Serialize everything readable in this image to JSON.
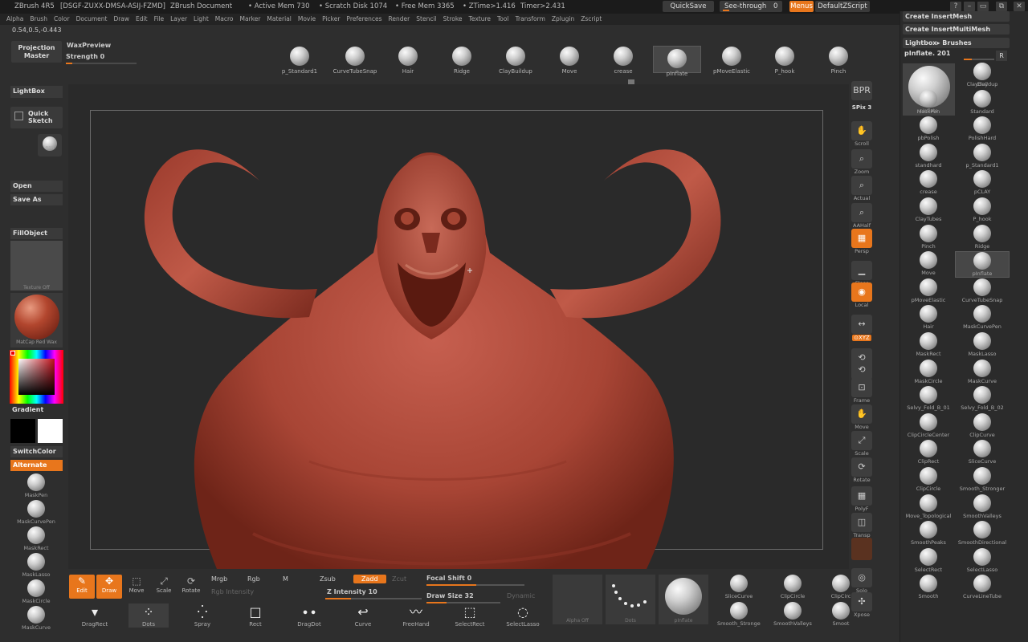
{
  "titlebar": {
    "app": "ZBrush 4R5",
    "serial": "[DSGF-ZUXX-DMSA-ASIJ-FZMD]",
    "document": "ZBrush Document",
    "active_mem": "• Active Mem 730",
    "scratch": "• Scratch Disk 1074",
    "free_mem": "• Free Mem 3365",
    "ztime": "• ZTime>1.416",
    "timer": "Timer>2.431",
    "quicksave": "QuickSave",
    "see_through": "See-through",
    "see_through_value": "0",
    "menus": "Menus",
    "script": "DefaultZScript",
    "win_buttons": [
      "?",
      "–",
      "▭",
      "⧉",
      "✕"
    ]
  },
  "menubar": [
    "Alpha",
    "Brush",
    "Color",
    "Document",
    "Draw",
    "Edit",
    "File",
    "Layer",
    "Light",
    "Macro",
    "Marker",
    "Material",
    "Movie",
    "Picker",
    "Preferences",
    "Render",
    "Stencil",
    "Stroke",
    "Texture",
    "Tool",
    "Transform",
    "Zplugin",
    "Zscript"
  ],
  "coords": "0.54,0.5,-0.443",
  "projection_master": "Projection Master",
  "wax_preview": "WaxPreview",
  "strength": "Strength 0",
  "top_brushes": [
    "p_Standard1",
    "CurveTubeSnap",
    "Hair",
    "Ridge",
    "ClayBuildup",
    "Move",
    "crease",
    "pInflate",
    "pMoveElastic",
    "P_hook",
    "Pinch"
  ],
  "left": {
    "lightbox": "LightBox",
    "quick_sketch": "Quick Sketch",
    "bpr": "BPR",
    "open": "Open",
    "save_as": "Save As",
    "fill_object": "FillObject",
    "texture_off": "Texture Off",
    "matcap": "MatCap Red Wax",
    "gradient": "Gradient",
    "switch_color": "SwitchColor",
    "alternate": "Alternate",
    "mask_brushes": [
      "MaskPen",
      "MaskCurvePen",
      "MaskRect",
      "MaskLasso",
      "MaskCircle",
      "MaskCurve"
    ]
  },
  "right_shelf": [
    {
      "icon": "BPR",
      "label": ""
    },
    {
      "icon": "",
      "label": "SPix 3"
    },
    {
      "icon": "✋",
      "label": "Scroll"
    },
    {
      "icon": "⌕",
      "label": "Zoom"
    },
    {
      "icon": "⌕",
      "label": "Actual"
    },
    {
      "icon": "⌕",
      "label": "AAHalf"
    },
    {
      "icon": "▦",
      "label": "Persp"
    },
    {
      "icon": "▁",
      "label": "Floor"
    },
    {
      "icon": "◉",
      "label": "Local"
    },
    {
      "icon": "↔",
      "label": "L.Sym"
    },
    {
      "icon": "",
      "label": "⊙XYZ"
    },
    {
      "icon": "⟲",
      "label": ""
    },
    {
      "icon": "⟲",
      "label": ""
    },
    {
      "icon": "⊡",
      "label": "Frame"
    },
    {
      "icon": "✋",
      "label": "Move"
    },
    {
      "icon": "⤢",
      "label": "Scale"
    },
    {
      "icon": "⟳",
      "label": "Rotate"
    },
    {
      "icon": "▦",
      "label": "PolyF"
    },
    {
      "icon": "◫",
      "label": "Transp"
    },
    {
      "icon": "",
      "label": ""
    },
    {
      "icon": "◎",
      "label": "Solo"
    },
    {
      "icon": "✣",
      "label": "Xpose"
    }
  ],
  "right_panel": {
    "create_insertmesh": "Create InsertMesh",
    "create_insertmultimesh": "Create InsertMultiMesh",
    "lightbox_brushes": "Lightbox▸ Brushes",
    "current_brush": "pInflate. 201",
    "r_button": "R",
    "current_brush_caption": "pInflate",
    "brushes": [
      "Clay",
      "ClayBuildup",
      "MaskPen",
      "Standard",
      "pbPolish",
      "PolishHard",
      "standhard",
      "p_Standard1",
      "crease",
      "pCLAY",
      "ClayTubes",
      "P_hook",
      "Pinch",
      "Ridge",
      "Move",
      "pInflate",
      "pMoveElastic",
      "CurveTubeSnap",
      "Hair",
      "MaskCurvePen",
      "MaskRect",
      "MaskLasso",
      "MaskCircle",
      "MaskCurve",
      "Selvy_Fold_B_01",
      "Selvy_Fold_B_02",
      "ClipCircleCenter",
      "ClipCurve",
      "ClipRect",
      "SliceCurve",
      "ClipCircle",
      "Smooth_Stronger",
      "Move_Topological",
      "SmoothValleys",
      "SmoothPeaks",
      "SmoothDirectional",
      "SelectRect",
      "SelectLasso",
      "Smooth",
      "CurveLineTube"
    ]
  },
  "bottom": {
    "modes": [
      {
        "label": "Edit",
        "active": true
      },
      {
        "label": "Draw",
        "active": true
      },
      {
        "label": "Move",
        "active": false
      },
      {
        "label": "Scale",
        "active": false
      },
      {
        "label": "Rotate",
        "active": false
      }
    ],
    "mrgb": "Mrgb",
    "rgb": "Rgb",
    "m": "M",
    "rgb_intensity": "Rgb Intensity",
    "zsub": "Zsub",
    "zadd": "Zadd",
    "zcut": "Zcut",
    "z_intensity": "Z Intensity 10",
    "z_intensity_value": 0.1,
    "focal_shift": "Focal Shift 0",
    "draw_size": "Draw Size 32",
    "dynamic": "Dynamic",
    "strokes": [
      "DragRect",
      "Dots",
      "Spray",
      "Rect",
      "DragDot",
      "Curve",
      "FreeHand",
      "SelectRect",
      "SelectLasso"
    ],
    "alpha_off": "Alpha Off",
    "dots": "Dots",
    "pinflate": "pInflate",
    "right_brushes": [
      "SliceCurve",
      "ClipCircle",
      "ClipCirc",
      "Smooth_Stronger",
      "SmoothValleys",
      "Smoot"
    ]
  }
}
